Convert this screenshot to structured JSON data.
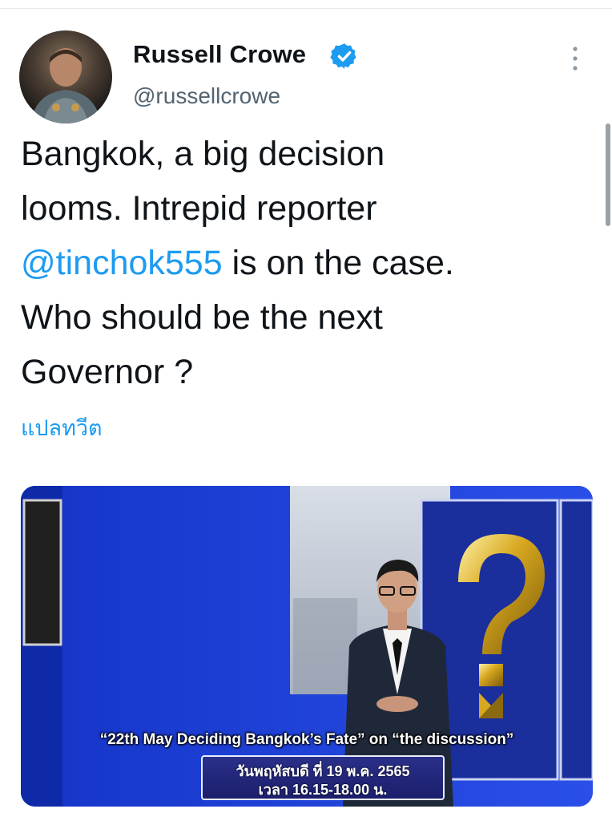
{
  "author": {
    "name": "Russell Crowe",
    "handle": "@russellcrowe"
  },
  "tweet": {
    "line1": "Bangkok, a big decision",
    "line2": "looms. Intrepid reporter",
    "mention": "@tinchok555",
    "line3_rest": " is on the case.",
    "line4": "Who should be the next",
    "line5": "Governor ?"
  },
  "translate_label": "แปลทวีต",
  "media": {
    "caption_line1": "“22th May Deciding Bangkok’s Fate” on “the discussion”",
    "caption_line2": "วันพฤหัสบดี ที่ 19 พ.ค. 2565",
    "caption_line3": "เวลา 16.15-18.00 น."
  },
  "colors": {
    "link": "#1d9bf0",
    "verified": "#1d9bf0",
    "handle": "#536471",
    "media_blue": "#1a3cd6"
  },
  "icons": [
    "verified-badge-icon",
    "more-options-icon"
  ]
}
